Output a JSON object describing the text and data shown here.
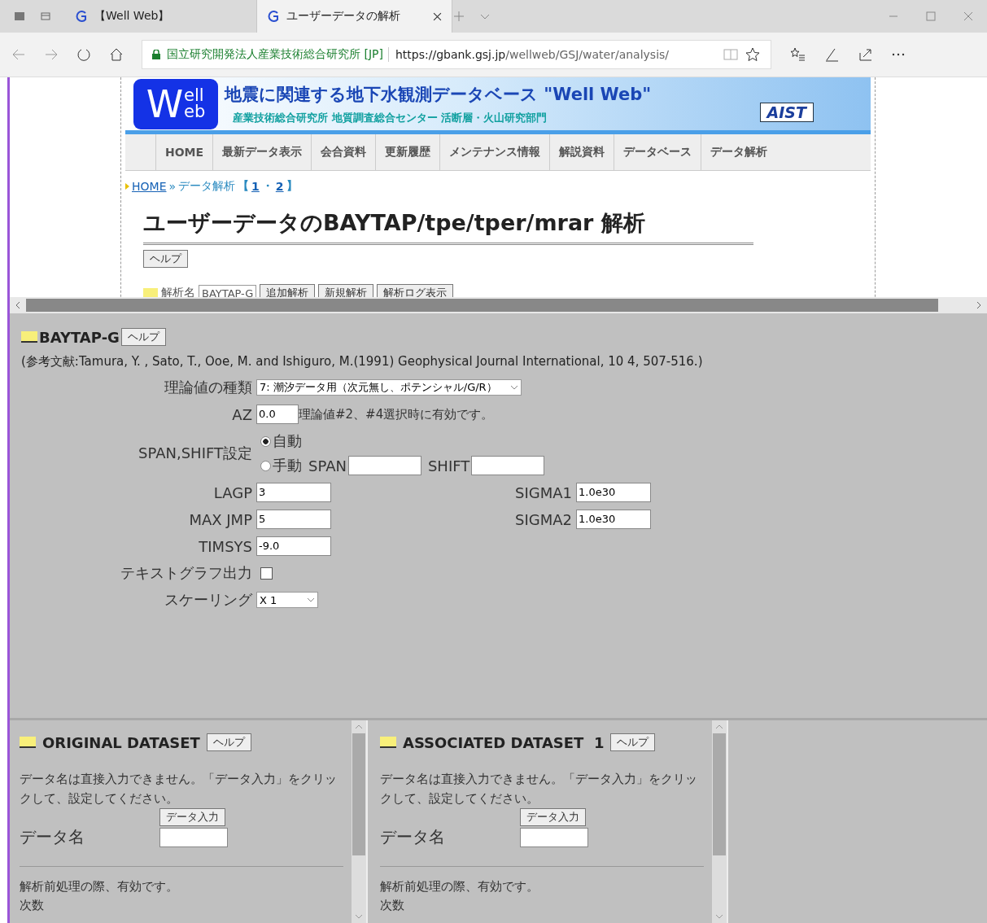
{
  "browser": {
    "tabs": [
      {
        "title": "【Well Web】",
        "selected": false
      },
      {
        "title": "ユーザーデータの解析",
        "selected": true
      }
    ],
    "site": "国立研究開発法人産業技術総合研究所 [JP]",
    "url_host": "https://gbank.gsj.jp",
    "url_path": "/wellweb/GSJ/water/analysis/"
  },
  "header": {
    "logo": [
      "W",
      "ell",
      "eb"
    ],
    "title": "地震に関連する地下水観測データベース \"Well Web\"",
    "subtitle": "産業技術総合研究所 地質調査総合センター 活断層・火山研究部門",
    "brand": "AIST",
    "nav": [
      "HOME",
      "最新データ表示",
      "会合資料",
      "更新履歴",
      "メンテナンス情報",
      "解説資料",
      "データベース",
      "データ解析"
    ]
  },
  "breadcrumb": {
    "home": "HOME",
    "separator": "»",
    "current": "データ解析",
    "open": "【",
    "pages": [
      "1",
      "2"
    ],
    "page_separator": "・",
    "close": "】"
  },
  "page": {
    "title": "ユーザーデータのBAYTAP/tpe/tper/mrar 解析",
    "help": "ヘルプ",
    "analysis_label": "解析名",
    "analysis_select": "BAYTAP-G",
    "buttons": [
      "追加解析",
      "新規解析",
      "解析ログ表示"
    ]
  },
  "baytap": {
    "title": "BAYTAP-G",
    "help": "ヘルプ",
    "reference": "(参考文献:Tamura, Y. , Sato, T., Ooe, M. and Ishiguro, M.(1991) Geophysical Journal International, 10 4, 507-516.)",
    "rows": [
      {
        "kind": "select",
        "label": "理論値の種類",
        "value": "7: 潮汐データ用（次元無し、ポテンシャル/G/R）"
      },
      {
        "kind": "input",
        "label": "AZ",
        "value": "0.0",
        "note": "理論値#2、#4選択時に有効です。"
      },
      {
        "kind": "radio",
        "label": "SPAN,SHIFT設定",
        "options": [
          {
            "label": "自動",
            "selected": true
          },
          {
            "label": "手動",
            "selected": false,
            "fields": [
              "SPAN",
              "SHIFT"
            ]
          }
        ]
      },
      {
        "kind": "pair",
        "label": "LAGP",
        "value": "3",
        "label2": "SIGMA1",
        "value2": "1.0e30"
      },
      {
        "kind": "pair",
        "label": "MAX JMP",
        "value": "5",
        "label2": "SIGMA2",
        "value2": "1.0e30"
      },
      {
        "kind": "input",
        "label": "TIMSYS",
        "value": "-9.0"
      },
      {
        "kind": "checkbox",
        "label": "テキストグラフ出力",
        "checked": false
      },
      {
        "kind": "small-select",
        "label": "スケーリング",
        "value": "X 1"
      }
    ]
  },
  "datasets": [
    {
      "title": "ORIGINAL DATASET",
      "help": "ヘルプ",
      "note": "データ名は直接入力できません。「データ入力」をクリックして、設定してください。",
      "button": "データ入力",
      "name_label": "データ名",
      "pre_note": "解析前処理の際、有効です。",
      "cut_label": "次数"
    },
    {
      "title": "ASSOCIATED DATASET  1",
      "help": "ヘルプ",
      "note": "データ名は直接入力できません。「データ入力」をクリックして、設定してください。",
      "button": "データ入力",
      "name_label": "データ名",
      "pre_note": "解析前処理の際、有効です。",
      "cut_label": "次数"
    }
  ]
}
